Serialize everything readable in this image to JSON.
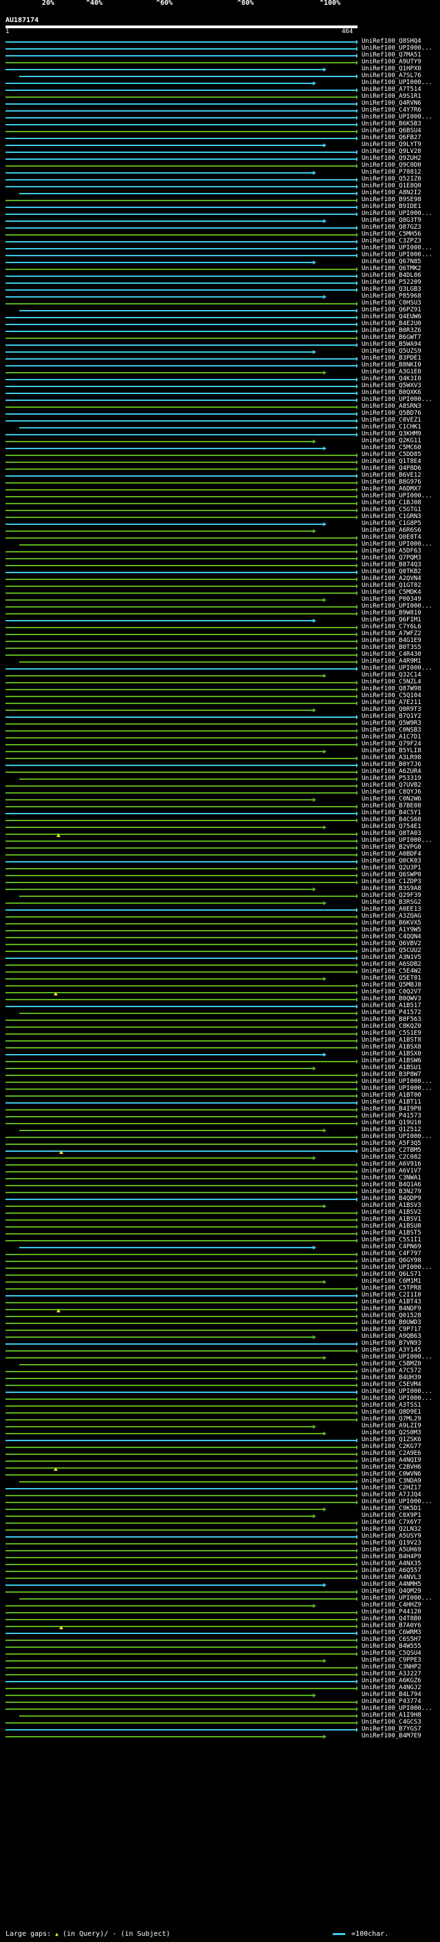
{
  "scale": {
    "ticks": [
      "20%",
      "^40%",
      "^60%",
      "^80%",
      "^100%"
    ],
    "colors": [
      "#e8142b",
      "#e8822a",
      "#8e3ab8",
      "#22a83a",
      "#2fc6e8"
    ]
  },
  "query": {
    "name": "AU187174",
    "start": "1",
    "end": "464"
  },
  "footer": {
    "large_gaps_label": "Large gaps:",
    "in_query_text": "(in Query)/",
    "in_subject_text": "(in Subject)",
    "legend_text": "=100char."
  },
  "colors": {
    "cyan": "#3ec8e6",
    "green": "#5db01e",
    "background": "#000000",
    "gap_marker": "#f4e52a"
  },
  "hits": [
    "UniRef100_Q8SHQ4",
    "UniRef100_UPI000...",
    "UniRef100_Q7MA51",
    "UniRef100_A9UTY9",
    "UniRef100_Q1HPX0",
    "UniRef100_A7SL76",
    "UniRef100_UPI000...",
    "UniRef100_A7T514",
    "UniRef100_A9S1R1",
    "UniRef100_Q4RVN6",
    "UniRef100_C4Y7R6",
    "UniRef100_UPI000...",
    "UniRef100_B6K5B3",
    "UniRef100_Q6BSU4",
    "UniRef100_Q6FB27",
    "UniRef100_Q9LYT9",
    "UniRef100_Q9LV28",
    "UniRef100_Q9ZUH2",
    "UniRef100_Q9C0D0",
    "UniRef100_P78812",
    "UniRef100_Q52IZ0",
    "UniRef100_Q1E8Q0",
    "UniRef100_A8N2I2",
    "UniRef100_B9SE98",
    "UniRef100_B9IDE1",
    "UniRef100_UPI000...",
    "UniRef100_Q8G3T9",
    "UniRef100_Q87GZ3",
    "UniRef100_C5MH56",
    "UniRef100_C3ZPZ3",
    "UniRef100_UPI000...",
    "UniRef100_UPI000...",
    "UniRef100_Q67N85",
    "UniRef100_Q6TMK2",
    "UniRef100_B4DL86",
    "UniRef100_P52209",
    "UniRef100_Q3LGB3",
    "UniRef100_P85968",
    "UniRef100_C0HSU3",
    "UniRef100_Q6PZ91",
    "UniRef100_Q4EUW6",
    "UniRef100_B4E2U0",
    "UniRef100_B0R3Z6",
    "UniRef100_B6GWT7",
    "UniRef100_B5WA94",
    "UniRef100_Q5UZS9",
    "UniRef100_B3PDE1",
    "UniRef100_B8NKI0",
    "UniRef100_A3G1E0",
    "UniRef100_Q4K3I0",
    "UniRef100_Q5WXV3",
    "UniRef100_B0QXK6",
    "UniRef100_UPI000...",
    "UniRef100_A8SRN3",
    "UniRef100_Q5BD76",
    "UniRef100_C0VEZ1",
    "UniRef100_C1CHK1",
    "UniRef100_Q3KHM9",
    "UniRef100_Q2KG11",
    "UniRef100_C5MC60",
    "UniRef100_C5DD85",
    "UniRef100_Q1T8E4",
    "UniRef100_Q4P8D6",
    "UniRef100_B6VE12",
    "UniRef100_B8G976",
    "UniRef100_A6DMX7",
    "UniRef100_UPI000...",
    "UniRef100_C1BJ08",
    "UniRef100_C5GTG1",
    "UniRef100_C1GRN3",
    "UniRef100_C1G8P5",
    "UniRef100_A6R6S6",
    "UniRef100_Q0E8T4",
    "UniRef100_UPI000...",
    "UniRef100_A5DF63",
    "UniRef100_Q7PQM3",
    "UniRef100_B874Q3",
    "UniRef100_Q0TKB2",
    "UniRef100_A2QVN4",
    "UniRef100_Q1GT02",
    "UniRef100_C5MDK4",
    "UniRef100_P00349",
    "UniRef100_UPI000...",
    "UniRef100_B9W810",
    "UniRef100_Q6FIM1",
    "UniRef100_C7Y6L6",
    "UniRef100_A7WFZ2",
    "UniRef100_B4G1E9",
    "UniRef100_B0T3S5",
    "UniRef100_C4R430",
    "UniRef100_A4R9M1",
    "UniRef100_UPI000...",
    "UniRef100_Q32C14",
    "UniRef100_C5NZL4",
    "UniRef100_Q87W98",
    "UniRef100_C5Q104",
    "UniRef100_A7E211",
    "UniRef100_Q0R9T3",
    "UniRef100_B7Q1Y2",
    "UniRef100_Q5W9R3",
    "UniRef100_C0NSB3",
    "UniRef100_A1C7D1",
    "UniRef100_Q79F24",
    "UniRef100_B5YLI8",
    "UniRef100_A3LR98",
    "UniRef100_B0Y7J6",
    "UniRef100_A6ZUR4",
    "UniRef100_P53319",
    "UniRef100_Q7UVB2",
    "UniRef100_C8QYJ6",
    "UniRef100_C0N2W6",
    "UniRef100_B7BE08",
    "UniRef100_B4C5Y1",
    "UniRef100_B4CS60",
    "UniRef100_Q754E1",
    "UniRef100_Q8TA03",
    "UniRef100_UPI000...",
    "UniRef100_B2VPG0",
    "UniRef100_A0BDF4",
    "UniRef100_Q0CK03",
    "UniRef100_Q2U3P1",
    "UniRef100_Q6SWP0",
    "UniRef100_C1ZDP3",
    "UniRef100_B3S9A8",
    "UniRef100_Q29F39",
    "UniRef100_B3RSG2",
    "UniRef100_A0EE13",
    "UniRef100_A3ZQAG",
    "UniRef100_B6KVX5",
    "UniRef100_A1Y9W5",
    "UniRef100_C4QQN4",
    "UniRef100_Q6VBV2",
    "UniRef100_Q5CUU2",
    "UniRef100_A3N1V5",
    "UniRef100_A6SDB2",
    "UniRef100_C5E4W2",
    "UniRef100_Q5ET01",
    "UniRef100_Q5MBJ8",
    "UniRef100_C0Q2V7",
    "UniRef100_B0QWV3",
    "UniRef100_A1B517",
    "UniRef100_P41572",
    "UniRef100_B8F563",
    "UniRef100_C8KQZ0",
    "UniRef100_C5S1E9",
    "UniRef100_A1BST8",
    "UniRef100_A1BSX8",
    "UniRef100_A1BSX0",
    "UniRef100_A1BSW6",
    "UniRef100_A1BSU1",
    "UniRef100_B3P8W7",
    "UniRef100_UPI000...",
    "UniRef100_UPI000...",
    "UniRef100_A1BT00",
    "UniRef100_A1BT11",
    "UniRef100_B4I9P8",
    "UniRef100_P41573",
    "UniRef100_Q19U10",
    "UniRef100_Q1Z512",
    "UniRef100_UPI000...",
    "UniRef100_A5F3Q5",
    "UniRef100_C2TBM5",
    "UniRef100_C2C082",
    "UniRef100_A6V916",
    "UniRef100_A6V1V7",
    "UniRef100_C3NWA1",
    "UniRef100_B4Q1A6",
    "UniRef100_B3N279",
    "UniRef100_B4QDP9",
    "UniRef100_A1BSV3",
    "UniRef100_A1BSV2",
    "UniRef100_A1BSV1",
    "UniRef100_A1BSU0",
    "UniRef100_A1BST5",
    "UniRef100_C5S1I1",
    "UniRef100_C4PN69",
    "UniRef100_C4F797",
    "UniRef100_Q6GY98",
    "UniRef100_UPI000...",
    "UniRef100_Q6LS71",
    "UniRef100_C6M1M1",
    "UniRef100_C5TPR8",
    "UniRef100_C2I1I0",
    "UniRef100_A1BT43",
    "UniRef100_B4NDF9",
    "UniRef100_Q01528",
    "UniRef100_B0UWD3",
    "UniRef100_C9P717",
    "UniRef100_A9QB63",
    "UniRef100_B7VN93",
    "UniRef100_A3Y145",
    "UniRef100_UPI000...",
    "UniRef100_C5BMZ0",
    "UniRef100_A7C572",
    "UniRef100_B4UH39",
    "UniRef100_C5EVM4",
    "UniRef100_UPI000...",
    "UniRef100_UPI000...",
    "UniRef100_A3TSS1",
    "UniRef100_Q8D9E1",
    "UniRef100_Q7ML29",
    "UniRef100_A9LZI9",
    "UniRef100_Q2S0M3",
    "UniRef100_Q1ZSK6",
    "UniRef100_C2KG77",
    "UniRef100_C2A9E6",
    "UniRef100_A4NQI9",
    "UniRef100_C2BVH6",
    "UniRef100_C0WVN6",
    "UniRef100_C3NDA9",
    "UniRef100_C2HZ17",
    "UniRef100_A7JJQ4",
    "UniRef100_UPI000...",
    "UniRef100_C9K5D1",
    "UniRef100_C0X9P1",
    "UniRef100_C7X6Y7",
    "UniRef100_Q2LN32",
    "UniRef100_A5USY9",
    "UniRef100_Q19V23",
    "UniRef100_A5UH69",
    "UniRef100_B4H4P9",
    "UniRef100_A4NX35",
    "UniRef100_A6Q557",
    "UniRef100_A4NVL3",
    "UniRef100_A4NMH5",
    "UniRef100_Q4QM29",
    "UniRef100_UPI000...",
    "UniRef100_C4HHZ9",
    "UniRef100_P44120",
    "UniRef100_Q4T8B0",
    "UniRef100_B7A0Y6",
    "UniRef100_C6WRM3",
    "UniRef100_C6S5H7",
    "UniRef100_B4W555",
    "UniRef100_C5QSU4",
    "UniRef100_C9PPE3",
    "UniRef100_C3NHP2",
    "UniRef100_A3J227",
    "UniRef100_A6KGZ6",
    "UniRef100_A4NGJ2",
    "UniRef100_B4L794",
    "UniRef100_P43774",
    "UniRef100_UPI000...",
    "UniRef100_A1I9H8",
    "UniRef100_C4GCS3",
    "UniRef100_B7YGS7",
    "UniRef100_B4M7E9"
  ]
}
